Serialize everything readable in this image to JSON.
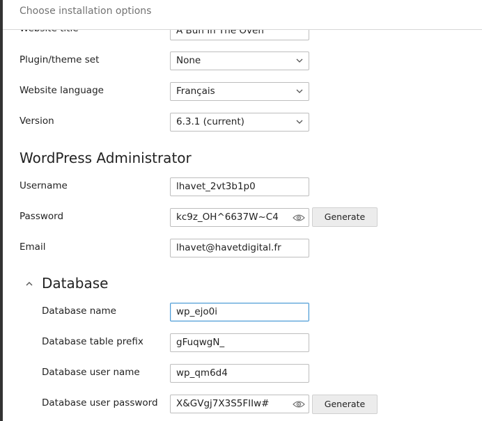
{
  "header": {
    "title": "Choose installation options"
  },
  "site": {
    "title_label": "Website title",
    "title_value": "A Bun In The Oven",
    "plugin_label": "Plugin/theme set",
    "plugin_value": "None",
    "language_label": "Website language",
    "language_value": "Français",
    "version_label": "Version",
    "version_value": "6.3.1 (current)"
  },
  "admin": {
    "section_title": "WordPress Administrator",
    "username_label": "Username",
    "username_value": "lhavet_2vt3b1p0",
    "password_label": "Password",
    "password_value": "kc9z_OH^6637W~C4",
    "generate_label": "Generate",
    "email_label": "Email",
    "email_value": "lhavet@havetdigital.fr"
  },
  "database": {
    "section_title": "Database",
    "name_label": "Database name",
    "name_value": "wp_ejo0i",
    "prefix_label": "Database table prefix",
    "prefix_value": "gFuqwgN_",
    "user_label": "Database user name",
    "user_value": "wp_qm6d4",
    "password_label": "Database user password",
    "password_value": "X&GVgj7X3S5FIIw#",
    "generate_label": "Generate"
  },
  "icons": {
    "select_arrow": "chevron-down-icon",
    "password_toggle": "eye-icon",
    "section_toggle": "chevron-up-icon"
  },
  "colors": {
    "focus_border": "#4b9bd6",
    "button_bg": "#ececec"
  }
}
